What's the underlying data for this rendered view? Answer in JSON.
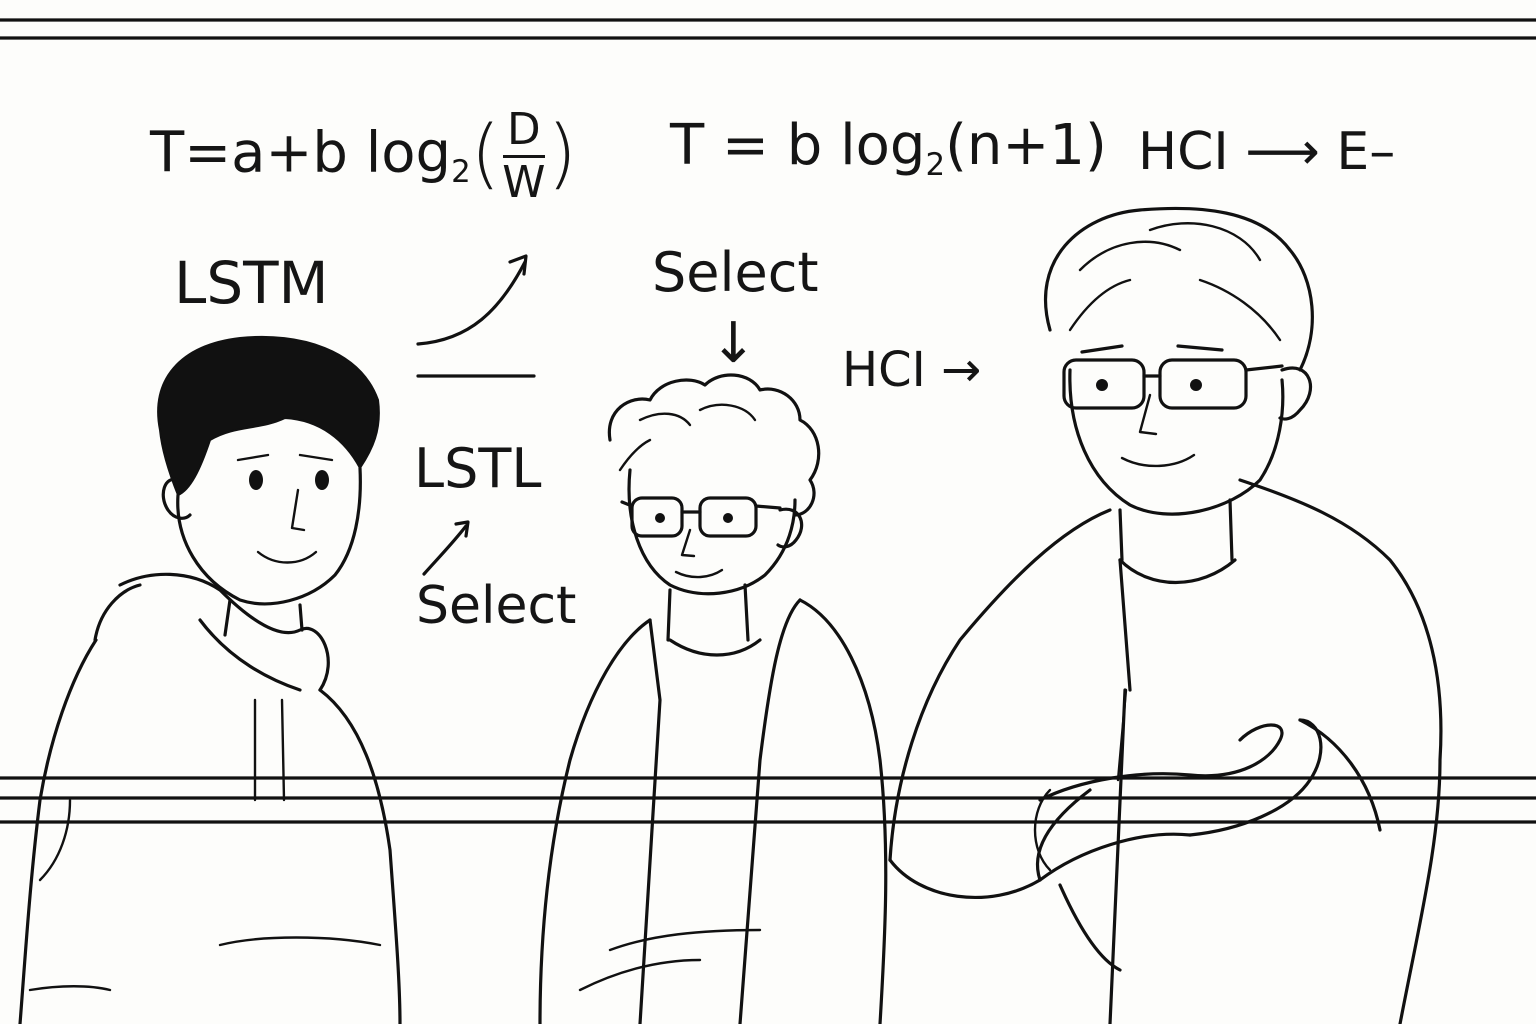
{
  "whiteboard": {
    "formula_fitts": {
      "lhs": "T=a+b log",
      "sub": "2",
      "num": "D",
      "den": "W"
    },
    "formula_hick": {
      "lhs": "T = b log",
      "sub": "2",
      "rhs": "(n+1)"
    },
    "arrow_top_right": "HCI ⟶ E–",
    "word_lstm": "LSTM",
    "word_lstl": "LSTL",
    "word_select_left": "Select",
    "word_select_center": "Select",
    "arrow_down": "↓",
    "label_hci": "HCI →"
  },
  "people": {
    "left": "person-hoodie-black-hair",
    "middle": "person-glasses-curly-hair",
    "right": "person-glasses-arms-crossed"
  },
  "colors": {
    "ink": "#111111",
    "board": "#fdfdfb"
  }
}
